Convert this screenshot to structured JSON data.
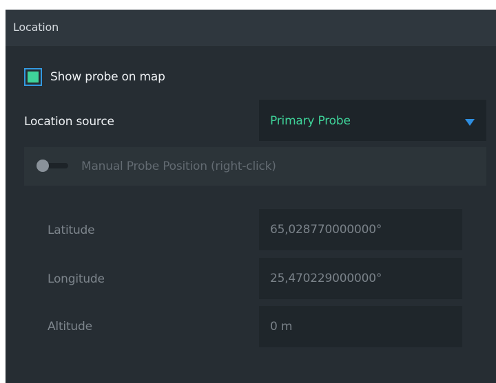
{
  "panel": {
    "title": "Location"
  },
  "show_probe": {
    "label": "Show probe on map",
    "checked": true
  },
  "location_source": {
    "label": "Location source",
    "selected": "Primary Probe"
  },
  "manual_position": {
    "label": "Manual Probe Position (right-click)",
    "enabled": false
  },
  "fields": {
    "latitude": {
      "label": "Latitude",
      "value": "65,028770000000°"
    },
    "longitude": {
      "label": "Longitude",
      "value": "25,470229000000°"
    },
    "altitude": {
      "label": "Altitude",
      "value": "0 m"
    }
  },
  "colors": {
    "accent_green": "#3fd49a",
    "accent_blue": "#2e8ee0",
    "panel_bg": "#262d33"
  },
  "icons": {
    "dropdown": "triangle-down-icon"
  }
}
